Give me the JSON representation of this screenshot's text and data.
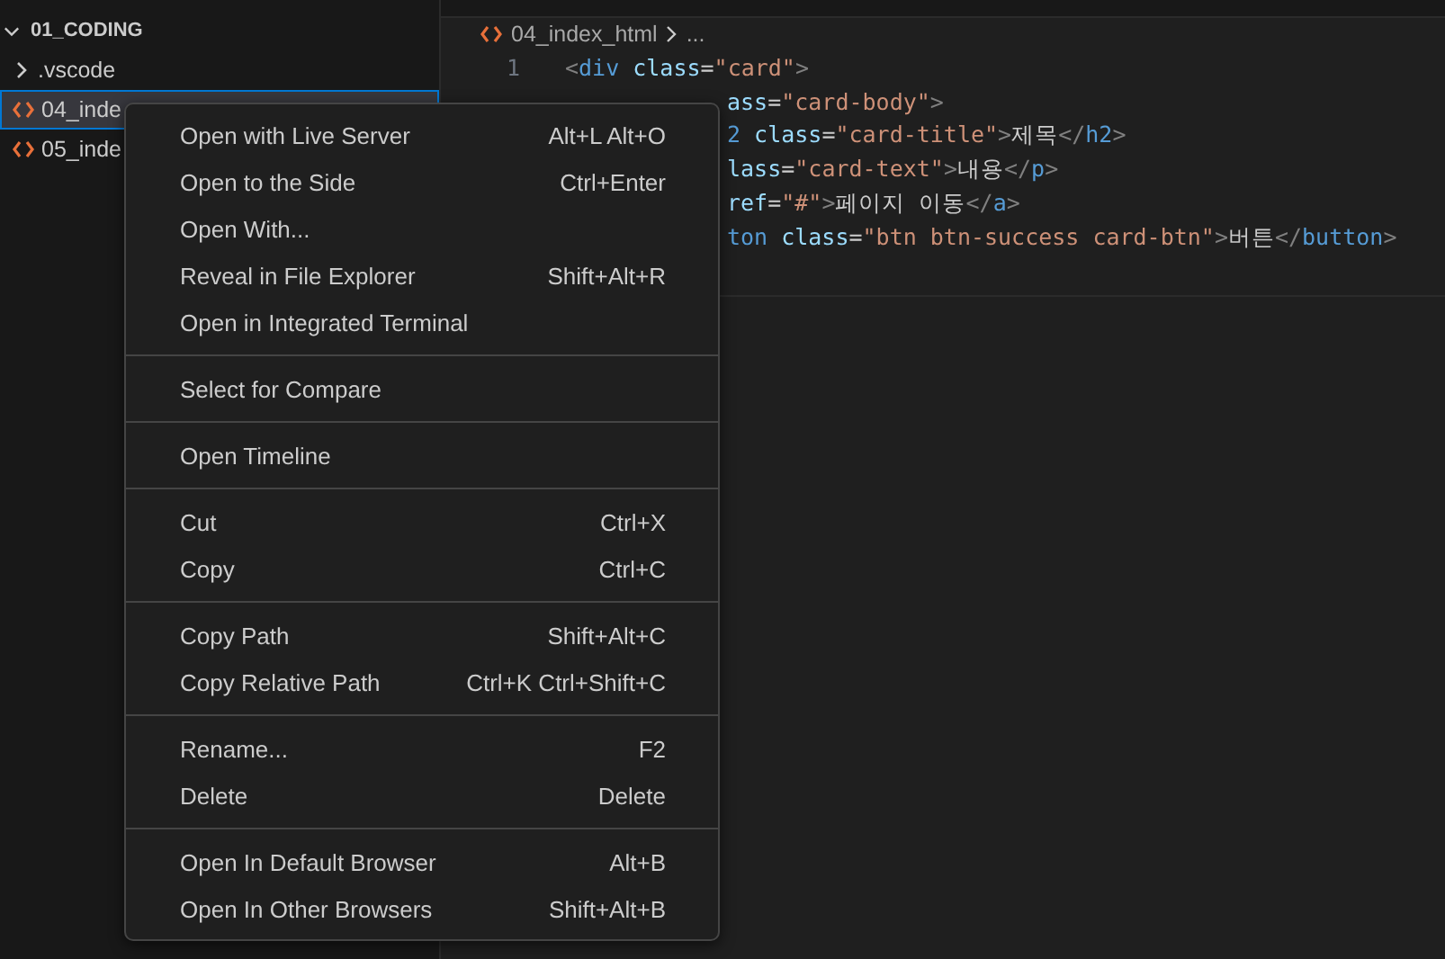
{
  "explorer": {
    "folder": "01_CODING",
    "expanded": true,
    "items": [
      {
        "name": ".vscode",
        "kind": "folder",
        "selected": false
      },
      {
        "name": "04_inde",
        "kind": "html",
        "selected": true
      },
      {
        "name": "05_inde",
        "kind": "html",
        "selected": false
      }
    ]
  },
  "breadcrumb": {
    "file": "04_index_html",
    "more": "..."
  },
  "code_lines": [
    {
      "number": "1",
      "tokens": [
        {
          "text": "<",
          "kind": "punct"
        },
        {
          "text": "div",
          "kind": "tag"
        },
        {
          "text": " class",
          "kind": "attr"
        },
        {
          "text": "=",
          "kind": "text"
        },
        {
          "text": "\"card\"",
          "kind": "string"
        },
        {
          "text": ">",
          "kind": "punct"
        }
      ]
    },
    {
      "hidden_start": true,
      "tokens": [
        {
          "text": "ass",
          "kind": "attr"
        },
        {
          "text": "=",
          "kind": "text"
        },
        {
          "text": "\"card-body\"",
          "kind": "string"
        },
        {
          "text": ">",
          "kind": "punct"
        }
      ]
    },
    {
      "hidden_start": true,
      "tokens": [
        {
          "text": "2",
          "kind": "tag"
        },
        {
          "text": " class",
          "kind": "attr"
        },
        {
          "text": "=",
          "kind": "text"
        },
        {
          "text": "\"card-title\"",
          "kind": "string"
        },
        {
          "text": ">",
          "kind": "punct"
        },
        {
          "text": "제목",
          "kind": "text"
        },
        {
          "text": "</",
          "kind": "punct"
        },
        {
          "text": "h2",
          "kind": "tag"
        },
        {
          "text": ">",
          "kind": "punct"
        }
      ]
    },
    {
      "hidden_start": true,
      "tokens": [
        {
          "text": "lass",
          "kind": "attr"
        },
        {
          "text": "=",
          "kind": "text"
        },
        {
          "text": "\"card-text\"",
          "kind": "string"
        },
        {
          "text": ">",
          "kind": "punct"
        },
        {
          "text": "내용",
          "kind": "text"
        },
        {
          "text": "</",
          "kind": "punct"
        },
        {
          "text": "p",
          "kind": "tag"
        },
        {
          "text": ">",
          "kind": "punct"
        }
      ]
    },
    {
      "hidden_start": true,
      "tokens": [
        {
          "text": "ref",
          "kind": "attr"
        },
        {
          "text": "=",
          "kind": "text"
        },
        {
          "text": "\"#\"",
          "kind": "string"
        },
        {
          "text": ">",
          "kind": "punct"
        },
        {
          "text": "페이지 이동",
          "kind": "text"
        },
        {
          "text": "</",
          "kind": "punct"
        },
        {
          "text": "a",
          "kind": "tag"
        },
        {
          "text": ">",
          "kind": "punct"
        }
      ]
    },
    {
      "hidden_start": true,
      "tokens": [
        {
          "text": "ton",
          "kind": "tag"
        },
        {
          "text": " class",
          "kind": "attr"
        },
        {
          "text": "=",
          "kind": "text"
        },
        {
          "text": "\"btn btn-success card-btn\"",
          "kind": "string"
        },
        {
          "text": ">",
          "kind": "punct"
        },
        {
          "text": "버튼",
          "kind": "text"
        },
        {
          "text": "</",
          "kind": "punct"
        },
        {
          "text": "button",
          "kind": "tag"
        },
        {
          "text": ">",
          "kind": "punct"
        }
      ]
    }
  ],
  "context_menu": {
    "groups": [
      [
        {
          "label": "Open with Live Server",
          "shortcut": "Alt+L Alt+O"
        },
        {
          "label": "Open to the Side",
          "shortcut": "Ctrl+Enter"
        },
        {
          "label": "Open With..."
        },
        {
          "label": "Reveal in File Explorer",
          "shortcut": "Shift+Alt+R"
        },
        {
          "label": "Open in Integrated Terminal"
        }
      ],
      [
        {
          "label": "Select for Compare"
        }
      ],
      [
        {
          "label": "Open Timeline"
        }
      ],
      [
        {
          "label": "Cut",
          "shortcut": "Ctrl+X"
        },
        {
          "label": "Copy",
          "shortcut": "Ctrl+C"
        }
      ],
      [
        {
          "label": "Copy Path",
          "shortcut": "Shift+Alt+C"
        },
        {
          "label": "Copy Relative Path",
          "shortcut": "Ctrl+K Ctrl+Shift+C"
        }
      ],
      [
        {
          "label": "Rename...",
          "shortcut": "F2"
        },
        {
          "label": "Delete",
          "shortcut": "Delete"
        }
      ],
      [
        {
          "label": "Open In Default Browser",
          "shortcut": "Alt+B"
        },
        {
          "label": "Open In Other Browsers",
          "shortcut": "Shift+Alt+B"
        }
      ]
    ]
  }
}
